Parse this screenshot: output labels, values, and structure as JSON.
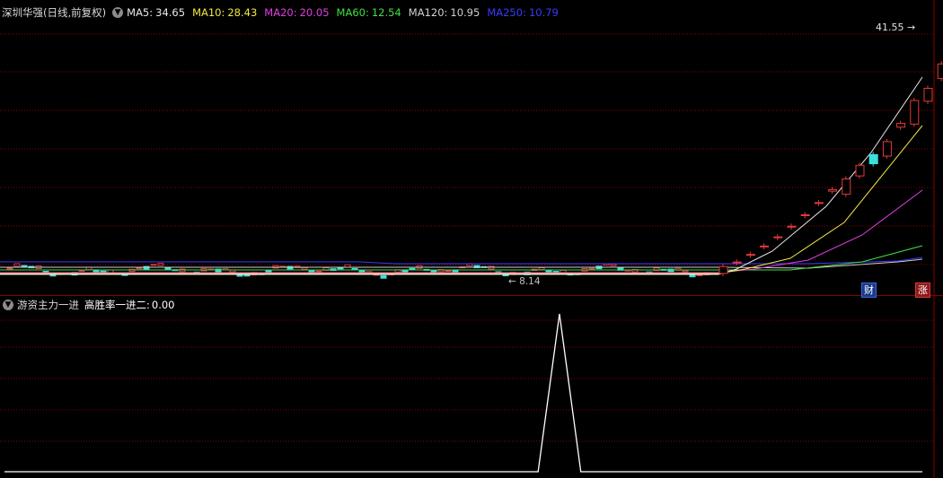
{
  "header": {
    "title": "深圳华强(日线,前复权)",
    "arrow_icon": "chevron-down-icon",
    "ma": [
      {
        "label": "MA5:",
        "value": "34.65",
        "color": "#e8e8e8"
      },
      {
        "label": "MA10:",
        "value": "28.43",
        "color": "#f2e640"
      },
      {
        "label": "MA20:",
        "value": "20.05",
        "color": "#e23ee2"
      },
      {
        "label": "MA60:",
        "value": "12.54",
        "color": "#40e040"
      },
      {
        "label": "MA120:",
        "value": "10.95",
        "color": "#d0d0d0"
      },
      {
        "label": "MA250:",
        "value": "10.79",
        "color": "#3a3aff"
      }
    ]
  },
  "price_labels": {
    "high": "41.55",
    "low": "8.14"
  },
  "badges": {
    "cai": "财",
    "zhang": "涨"
  },
  "indicator": {
    "name": "游资主力一进",
    "label": "高胜率一进二:",
    "value": "0.00"
  },
  "colors": {
    "up": "#e23a3a",
    "down": "#3ae0e0",
    "grid": "#8b0000",
    "background": "#000000"
  },
  "chart_data": {
    "type": "candlestick",
    "candles_recent": [
      {
        "open": 8.6,
        "close": 9.5
      },
      {
        "open": 10.0,
        "close": 10.1
      },
      {
        "open": 11.0,
        "close": 11.1
      },
      {
        "open": 12.1,
        "close": 12.2
      },
      {
        "open": 13.3,
        "close": 13.4
      },
      {
        "open": 14.7,
        "close": 14.8
      },
      {
        "open": 16.2,
        "close": 16.3
      },
      {
        "open": 17.8,
        "close": 17.9
      },
      {
        "open": 19.4,
        "close": 19.6
      },
      {
        "open": 19.0,
        "close": 21.0
      },
      {
        "open": 21.4,
        "close": 22.8
      },
      {
        "open": 24.2,
        "close": 23.0
      },
      {
        "open": 24.0,
        "close": 25.9
      },
      {
        "open": 27.8,
        "close": 28.3
      },
      {
        "open": 28.2,
        "close": 31.3
      },
      {
        "open": 31.2,
        "close": 32.9
      },
      {
        "open": 34.2,
        "close": 36.1
      },
      {
        "open": 39.0,
        "close": 41.55
      }
    ],
    "indicator_series": [
      0,
      0,
      0,
      0,
      0,
      0,
      0,
      0,
      0,
      0,
      0,
      0,
      0,
      0,
      0,
      0,
      0,
      0,
      0,
      0,
      0,
      0,
      0,
      0,
      0,
      0,
      1,
      0,
      0,
      0,
      0,
      0,
      0,
      0,
      0,
      0,
      0,
      0,
      0,
      0,
      0,
      0,
      0,
      0
    ]
  }
}
